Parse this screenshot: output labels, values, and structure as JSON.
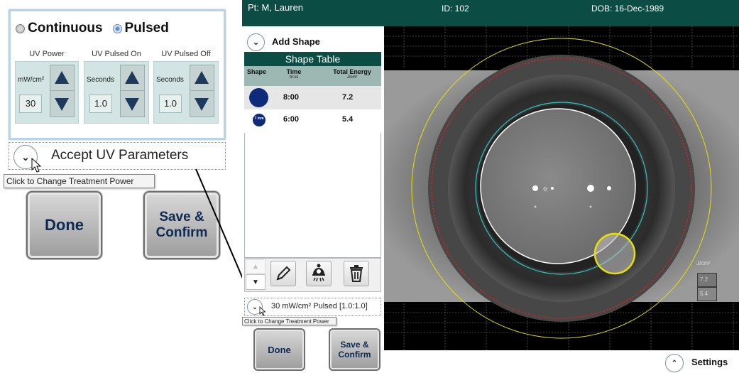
{
  "zoom": {
    "modes": {
      "continuous": "Continuous",
      "pulsed": "Pulsed"
    },
    "groups": [
      {
        "title": "UV Power",
        "unit": "mW/cm²",
        "value": "30"
      },
      {
        "title": "UV Pulsed On",
        "unit": "Seconds",
        "value": "1.0"
      },
      {
        "title": "UV Pulsed Off",
        "unit": "Seconds",
        "value": "1.0"
      }
    ],
    "accept_label": "Accept UV Parameters",
    "tooltip": "Click to Change Treatment Power",
    "done": "Done",
    "save_confirm": "Save & Confirm"
  },
  "header": {
    "patient": "Pt: M, Lauren",
    "id": "ID: 102",
    "dob": "DOB: 16-Dec-1989"
  },
  "sidebar": {
    "add_shape": "Add Shape",
    "table_title": "Shape Table",
    "col_shape": "Shape",
    "col_time": "Time",
    "col_time_unit": "m:ss",
    "col_energy": "Total Energy",
    "col_energy_unit": "J/cm²",
    "rows": [
      {
        "time": "8:00",
        "energy": "7.2",
        "size": ""
      },
      {
        "time": "6:00",
        "energy": "5.4",
        "size": "7 mm"
      }
    ],
    "treatment": "30 mW/cm² Pulsed [1.0:1.0]",
    "tooltip": "Click to Change Treatment Power",
    "done": "Done",
    "save_confirm": "Save & Confirm"
  },
  "legend": {
    "unit": "J/cm²",
    "values": [
      "7.2",
      "5.4"
    ]
  },
  "settings": "Settings",
  "colors": {
    "header": "#0b4d45",
    "table_head": "#9db7b2",
    "shape_fill": "#0d2b7a",
    "yellow": "#e8e000",
    "red": "#e02020",
    "cyan": "#2ec8c8"
  }
}
